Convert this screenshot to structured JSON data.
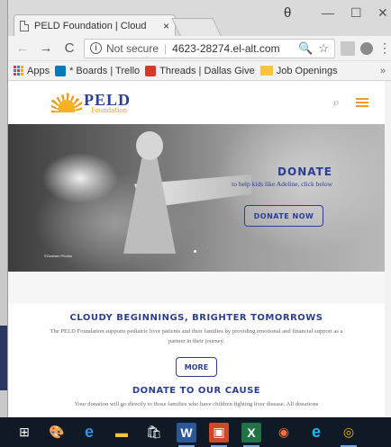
{
  "browser": {
    "tab_title": "PELD Foundation | Cloud",
    "tab_close": "×",
    "profile_icon": "θ",
    "win_minimize": "—",
    "win_maximize": "☐",
    "win_close": "✕",
    "back": "←",
    "forward": "→",
    "reload": "C",
    "security_label": "Not secure",
    "url": "4623-28274.el-alt.com",
    "zoom_icon": "🔍",
    "star_icon": "☆",
    "menu_icon": "⋮"
  },
  "bookmarks": [
    {
      "label": "Apps",
      "icon": "apps-grid-icon"
    },
    {
      "label": "* Boards | Trello",
      "icon": "trello-icon"
    },
    {
      "label": "Threads | Dallas Give",
      "icon": "threads-icon"
    },
    {
      "label": "Job Openings",
      "icon": "folder-icon"
    }
  ],
  "bookmarks_more": "»",
  "site": {
    "logo_main": "PELD",
    "logo_sub": "Foundation",
    "search_icon": "⌕",
    "hero": {
      "title": "Donate",
      "subtitle": "to help kids like Adeline, click below",
      "button": "Donate now",
      "credit": "©Graham Photos"
    },
    "section1": {
      "title": "Cloudy Beginnings, Brighter Tomorrows",
      "text": "The PELD Foundation supports pediatric liver patients and their families by providing emotional and financial support as a partner in their journey.",
      "button": "More"
    },
    "section2": {
      "title": "Donate to our cause",
      "text": "Your donation will go directly to those families who have children fighting liver disease. All donations"
    }
  },
  "taskbar": [
    {
      "name": "start",
      "glyph": "⊞"
    },
    {
      "name": "paint",
      "glyph": "🎨"
    },
    {
      "name": "edge",
      "glyph": "e"
    },
    {
      "name": "file-explorer",
      "glyph": "▬"
    },
    {
      "name": "store",
      "glyph": "🛍"
    },
    {
      "name": "word",
      "glyph": "W"
    },
    {
      "name": "photos",
      "glyph": "▣"
    },
    {
      "name": "excel",
      "glyph": "X"
    },
    {
      "name": "firefox",
      "glyph": "◉"
    },
    {
      "name": "ie",
      "glyph": "e"
    },
    {
      "name": "chrome",
      "glyph": "◎"
    }
  ],
  "colors": {
    "brand_blue": "#2a3e93",
    "brand_orange": "#f29b1d",
    "taskbar": "#0f1a26"
  }
}
